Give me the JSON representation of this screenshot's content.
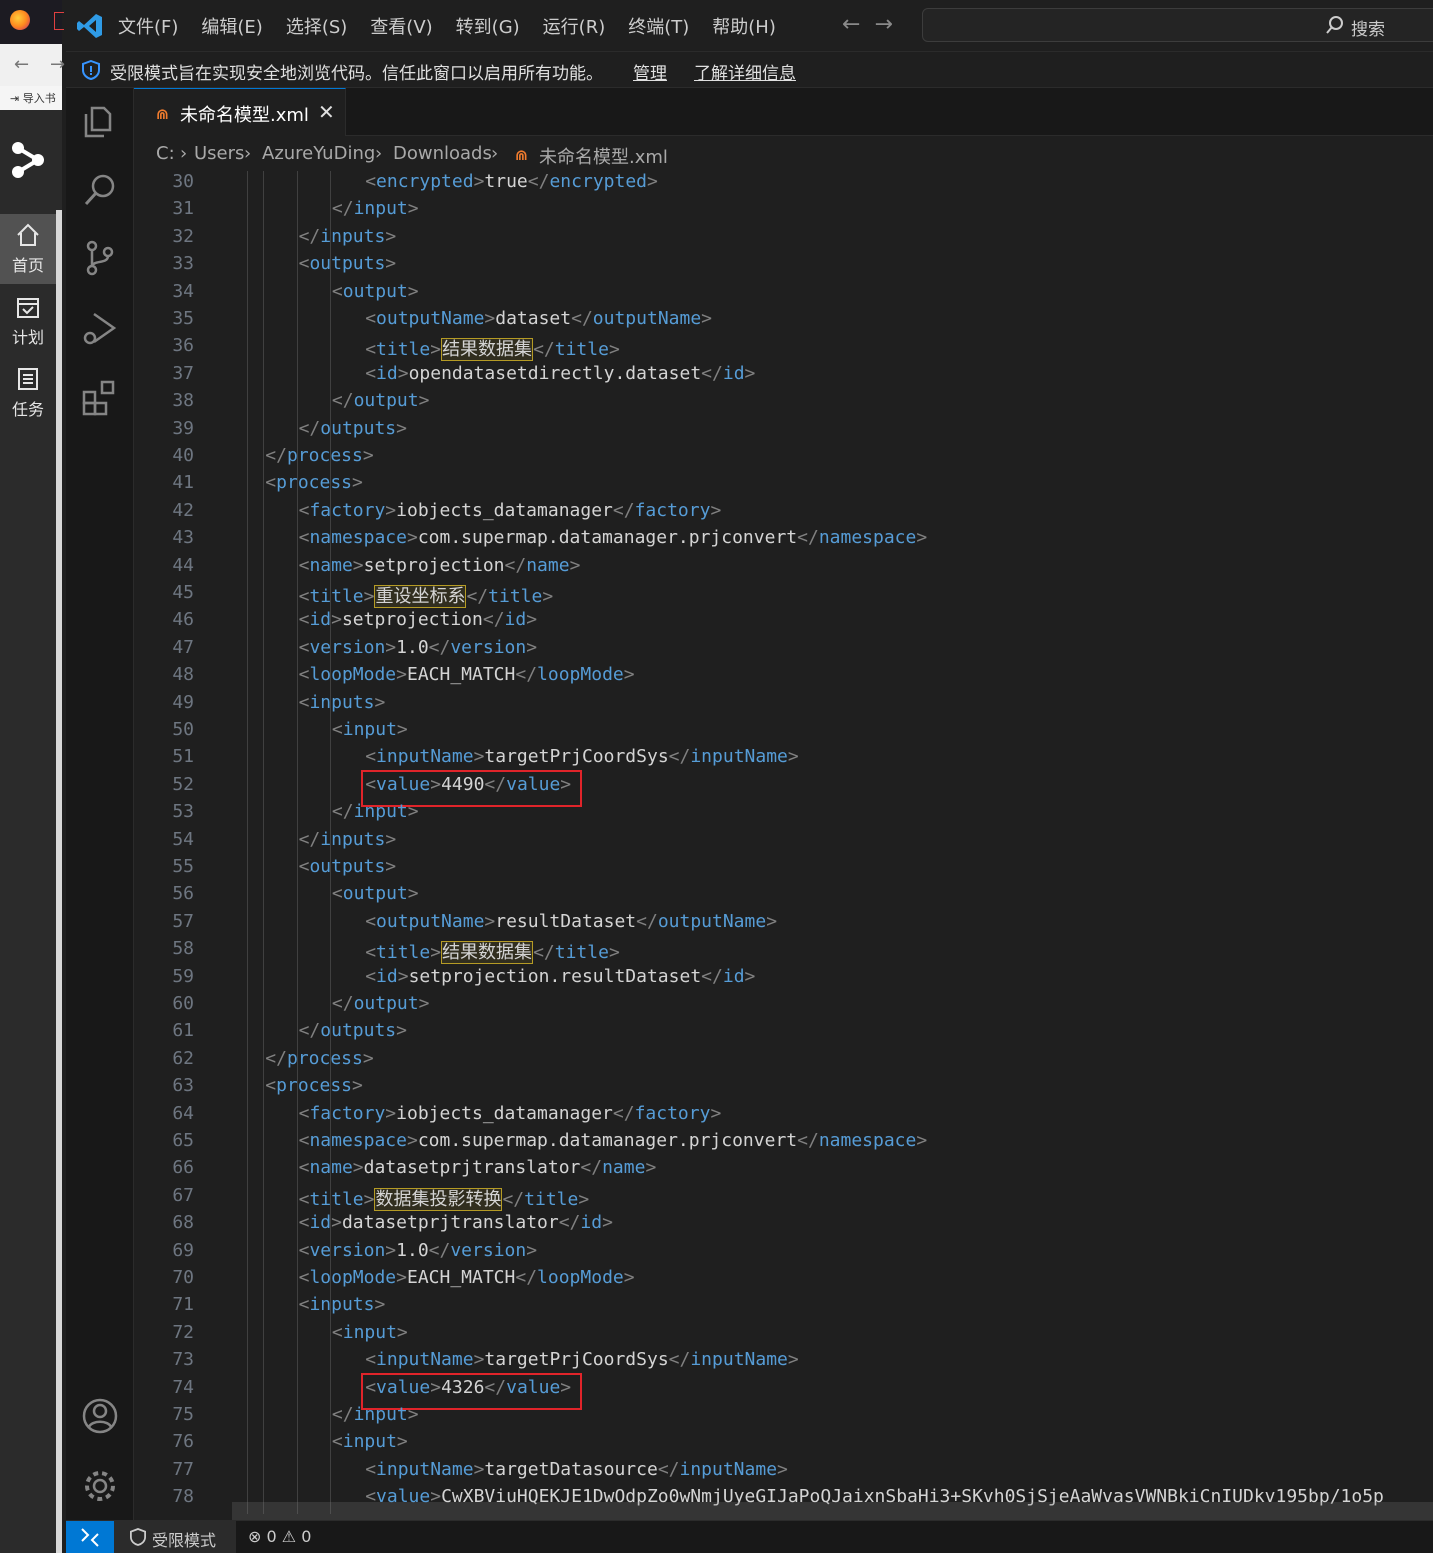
{
  "outer_app": {
    "import_label": "导入书",
    "sidebar": [
      {
        "label": "首页",
        "icon": "home-icon"
      },
      {
        "label": "计划",
        "icon": "calendar-check-icon"
      },
      {
        "label": "任务",
        "icon": "list-icon"
      }
    ]
  },
  "titlebar": {
    "menu": [
      "文件(F)",
      "编辑(E)",
      "选择(S)",
      "查看(V)",
      "转到(G)",
      "运行(R)",
      "终端(T)",
      "帮助(H)"
    ],
    "search_label": "搜索"
  },
  "banner": {
    "message": "受限模式旨在实现安全地浏览代码。信任此窗口以启用所有功能。",
    "manage": "管理",
    "learn_more": "了解详细信息"
  },
  "tab": {
    "label": "未命名模型.xml",
    "close": "✕"
  },
  "breadcrumbs": [
    "C:",
    "Users",
    "AzureYuDing",
    "Downloads",
    "未命名模型.xml"
  ],
  "editor": {
    "lines": [
      {
        "n": "30",
        "indent": 8,
        "tag": "encrypted",
        "text": "true"
      },
      {
        "n": "31",
        "indent": 6,
        "close": "input"
      },
      {
        "n": "32",
        "indent": 4,
        "close": "inputs"
      },
      {
        "n": "33",
        "indent": 4,
        "open": "outputs"
      },
      {
        "n": "34",
        "indent": 6,
        "open": "output"
      },
      {
        "n": "35",
        "indent": 8,
        "tag": "outputName",
        "text": "dataset"
      },
      {
        "n": "36",
        "indent": 8,
        "tag": "title",
        "text": "结果数据集",
        "highlight": true
      },
      {
        "n": "37",
        "indent": 8,
        "tag": "id",
        "text": "opendatasetdirectly.dataset"
      },
      {
        "n": "38",
        "indent": 6,
        "close": "output"
      },
      {
        "n": "39",
        "indent": 4,
        "close": "outputs"
      },
      {
        "n": "40",
        "indent": 2,
        "close": "process"
      },
      {
        "n": "41",
        "indent": 2,
        "open": "process"
      },
      {
        "n": "42",
        "indent": 4,
        "tag": "factory",
        "text": "iobjects_datamanager"
      },
      {
        "n": "43",
        "indent": 4,
        "tag": "namespace",
        "text": "com.supermap.datamanager.prjconvert"
      },
      {
        "n": "44",
        "indent": 4,
        "tag": "name",
        "text": "setprojection"
      },
      {
        "n": "45",
        "indent": 4,
        "tag": "title",
        "text": "重设坐标系",
        "highlight": true
      },
      {
        "n": "46",
        "indent": 4,
        "tag": "id",
        "text": "setprojection"
      },
      {
        "n": "47",
        "indent": 4,
        "tag": "version",
        "text": "1.0"
      },
      {
        "n": "48",
        "indent": 4,
        "tag": "loopMode",
        "text": "EACH_MATCH"
      },
      {
        "n": "49",
        "indent": 4,
        "open": "inputs"
      },
      {
        "n": "50",
        "indent": 6,
        "open": "input"
      },
      {
        "n": "51",
        "indent": 8,
        "tag": "inputName",
        "text": "targetPrjCoordSys"
      },
      {
        "n": "52",
        "indent": 8,
        "tag": "value",
        "text": "4490",
        "boxed": true
      },
      {
        "n": "53",
        "indent": 6,
        "close": "input"
      },
      {
        "n": "54",
        "indent": 4,
        "close": "inputs"
      },
      {
        "n": "55",
        "indent": 4,
        "open": "outputs"
      },
      {
        "n": "56",
        "indent": 6,
        "open": "output"
      },
      {
        "n": "57",
        "indent": 8,
        "tag": "outputName",
        "text": "resultDataset"
      },
      {
        "n": "58",
        "indent": 8,
        "tag": "title",
        "text": "结果数据集",
        "highlight": true
      },
      {
        "n": "59",
        "indent": 8,
        "tag": "id",
        "text": "setprojection.resultDataset"
      },
      {
        "n": "60",
        "indent": 6,
        "close": "output"
      },
      {
        "n": "61",
        "indent": 4,
        "close": "outputs"
      },
      {
        "n": "62",
        "indent": 2,
        "close": "process"
      },
      {
        "n": "63",
        "indent": 2,
        "open": "process"
      },
      {
        "n": "64",
        "indent": 4,
        "tag": "factory",
        "text": "iobjects_datamanager"
      },
      {
        "n": "65",
        "indent": 4,
        "tag": "namespace",
        "text": "com.supermap.datamanager.prjconvert"
      },
      {
        "n": "66",
        "indent": 4,
        "tag": "name",
        "text": "datasetprjtranslator"
      },
      {
        "n": "67",
        "indent": 4,
        "tag": "title",
        "text": "数据集投影转换",
        "highlight": true
      },
      {
        "n": "68",
        "indent": 4,
        "tag": "id",
        "text": "datasetprjtranslator"
      },
      {
        "n": "69",
        "indent": 4,
        "tag": "version",
        "text": "1.0"
      },
      {
        "n": "70",
        "indent": 4,
        "tag": "loopMode",
        "text": "EACH_MATCH"
      },
      {
        "n": "71",
        "indent": 4,
        "open": "inputs"
      },
      {
        "n": "72",
        "indent": 6,
        "open": "input"
      },
      {
        "n": "73",
        "indent": 8,
        "tag": "inputName",
        "text": "targetPrjCoordSys"
      },
      {
        "n": "74",
        "indent": 8,
        "tag": "value",
        "text": "4326",
        "boxed": true
      },
      {
        "n": "75",
        "indent": 6,
        "close": "input"
      },
      {
        "n": "76",
        "indent": 6,
        "open": "input"
      },
      {
        "n": "77",
        "indent": 8,
        "tag": "inputName",
        "text": "targetDatasource"
      },
      {
        "n": "78",
        "indent": 8,
        "tag": "value",
        "text": "CwXBViuHQEKJE1DwOdpZo0wNmjUyeGIJaPoQJaixnSbaHi3+SKvh0SjSjeAaWvasVWNBkiCnIUDkv195bp/1o5p",
        "open_only": true
      }
    ]
  },
  "statusbar": {
    "restricted": "受限模式",
    "errors": "0",
    "warnings": "0"
  }
}
